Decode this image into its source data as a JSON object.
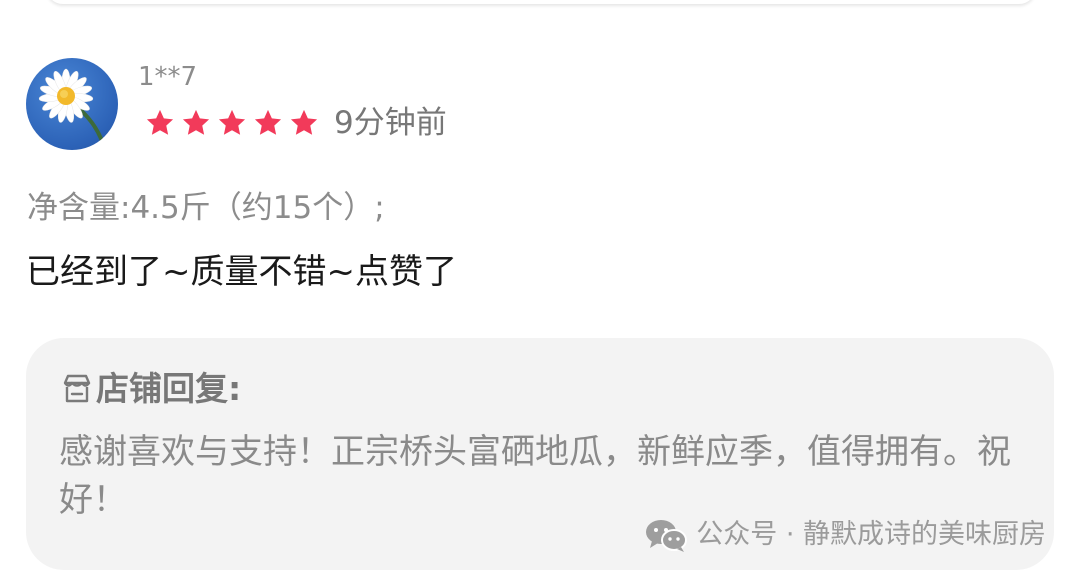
{
  "review": {
    "username": "1**7",
    "rating": 5,
    "time": "9分钟前",
    "spec": "净含量:4.5斤（约15个）;",
    "text": "已经到了~质量不错~点赞了"
  },
  "reply": {
    "label": "店铺回复:",
    "text": "感谢喜欢与支持！正宗桥头富硒地瓜，新鲜应季，值得拥有。祝好！"
  },
  "watermark": {
    "text": "公众号 · 静默成诗的美味厨房"
  },
  "colors": {
    "star": "#f23a5a",
    "reply_bg": "#f3f3f3",
    "avatar_bg": "#2c62b7"
  },
  "icons": {
    "avatar": "daisy-avatar",
    "rating": "star-icon",
    "store": "store-icon",
    "watermark": "wechat-icon"
  }
}
